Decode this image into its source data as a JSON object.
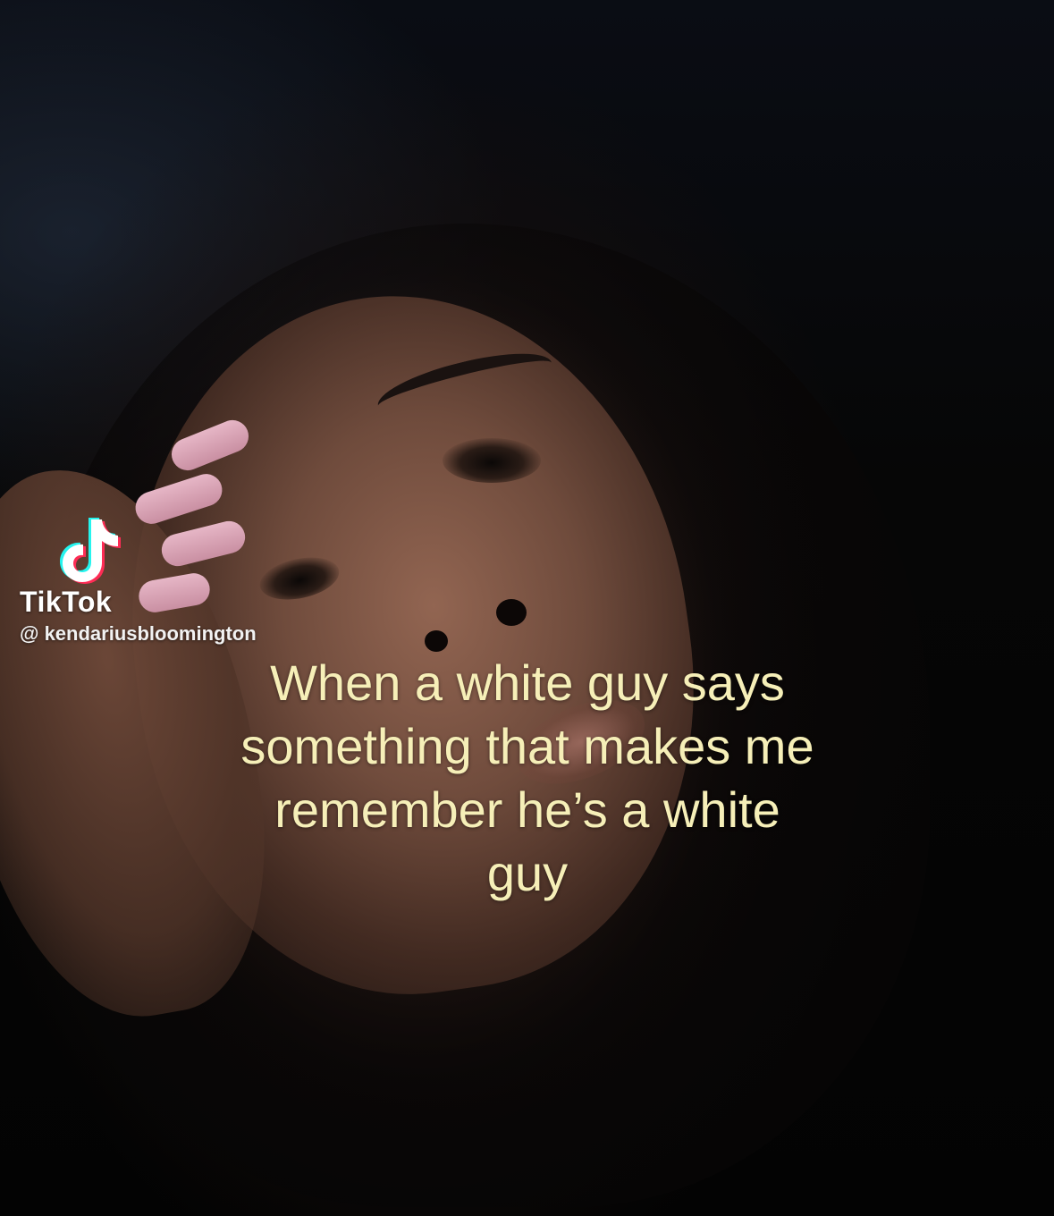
{
  "watermark": {
    "brand": "TikTok",
    "handle": "@ kendariusbloomington",
    "icon": "tiktok-logo-icon"
  },
  "caption": {
    "lines": [
      "When a white guy says",
      "something that makes me",
      "remember he’s a white",
      "guy"
    ],
    "color": "#f6efb8"
  }
}
